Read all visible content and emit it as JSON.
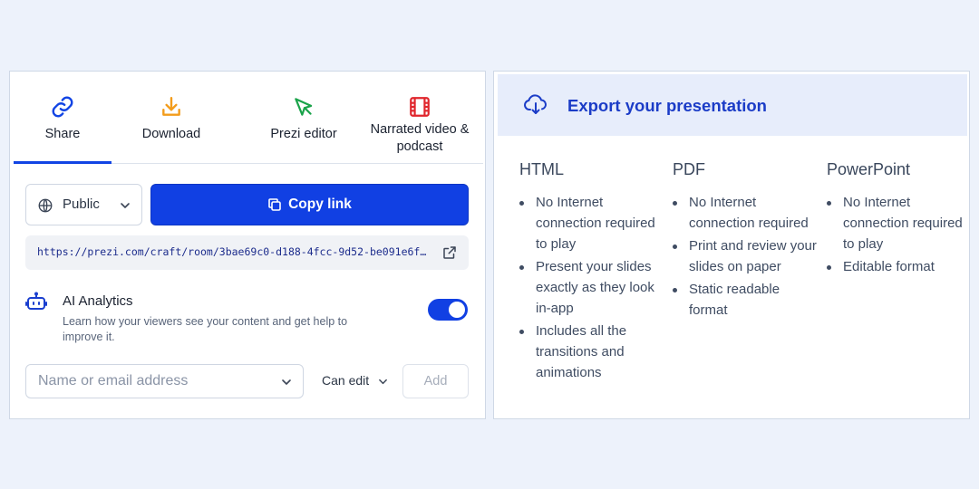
{
  "share_panel": {
    "tabs": [
      {
        "label": "Share",
        "icon": "link-icon",
        "color": "#1144e4"
      },
      {
        "label": "Download",
        "icon": "download-icon",
        "color": "#f39c1b"
      },
      {
        "label": "Prezi editor",
        "icon": "cursor-icon",
        "color": "#1aa34a"
      },
      {
        "label": "Narrated video & podcast",
        "icon": "film-icon",
        "color": "#e0262d"
      }
    ],
    "active_tab": "Share",
    "visibility": {
      "value": "Public"
    },
    "copy_link_label": "Copy link",
    "link": "https://prezi.com/craft/room/3bae69c0-d188-4fcc-9d52-be091e6fc…",
    "ai": {
      "title": "AI Analytics",
      "description": "Learn how your viewers see your content and get help to improve it.",
      "enabled": true
    },
    "invite": {
      "placeholder": "Name or email address",
      "permission": "Can edit",
      "add_label": "Add"
    }
  },
  "export_panel": {
    "title": "Export your presentation",
    "formats": [
      {
        "name": "HTML",
        "features": [
          "No Internet connection required to play",
          "Present your slides exactly as they look in-app",
          "Includes all the transitions and animations"
        ]
      },
      {
        "name": "PDF",
        "features": [
          "No Internet connection required",
          "Print and review your slides on paper",
          "Static readable format"
        ]
      },
      {
        "name": "PowerPoint",
        "features": [
          "No Internet connection required to play",
          "Editable format"
        ]
      }
    ]
  },
  "colors": {
    "accent": "#1140e3",
    "background": "#edf2fb",
    "export_header_bg": "#e7edfb"
  }
}
